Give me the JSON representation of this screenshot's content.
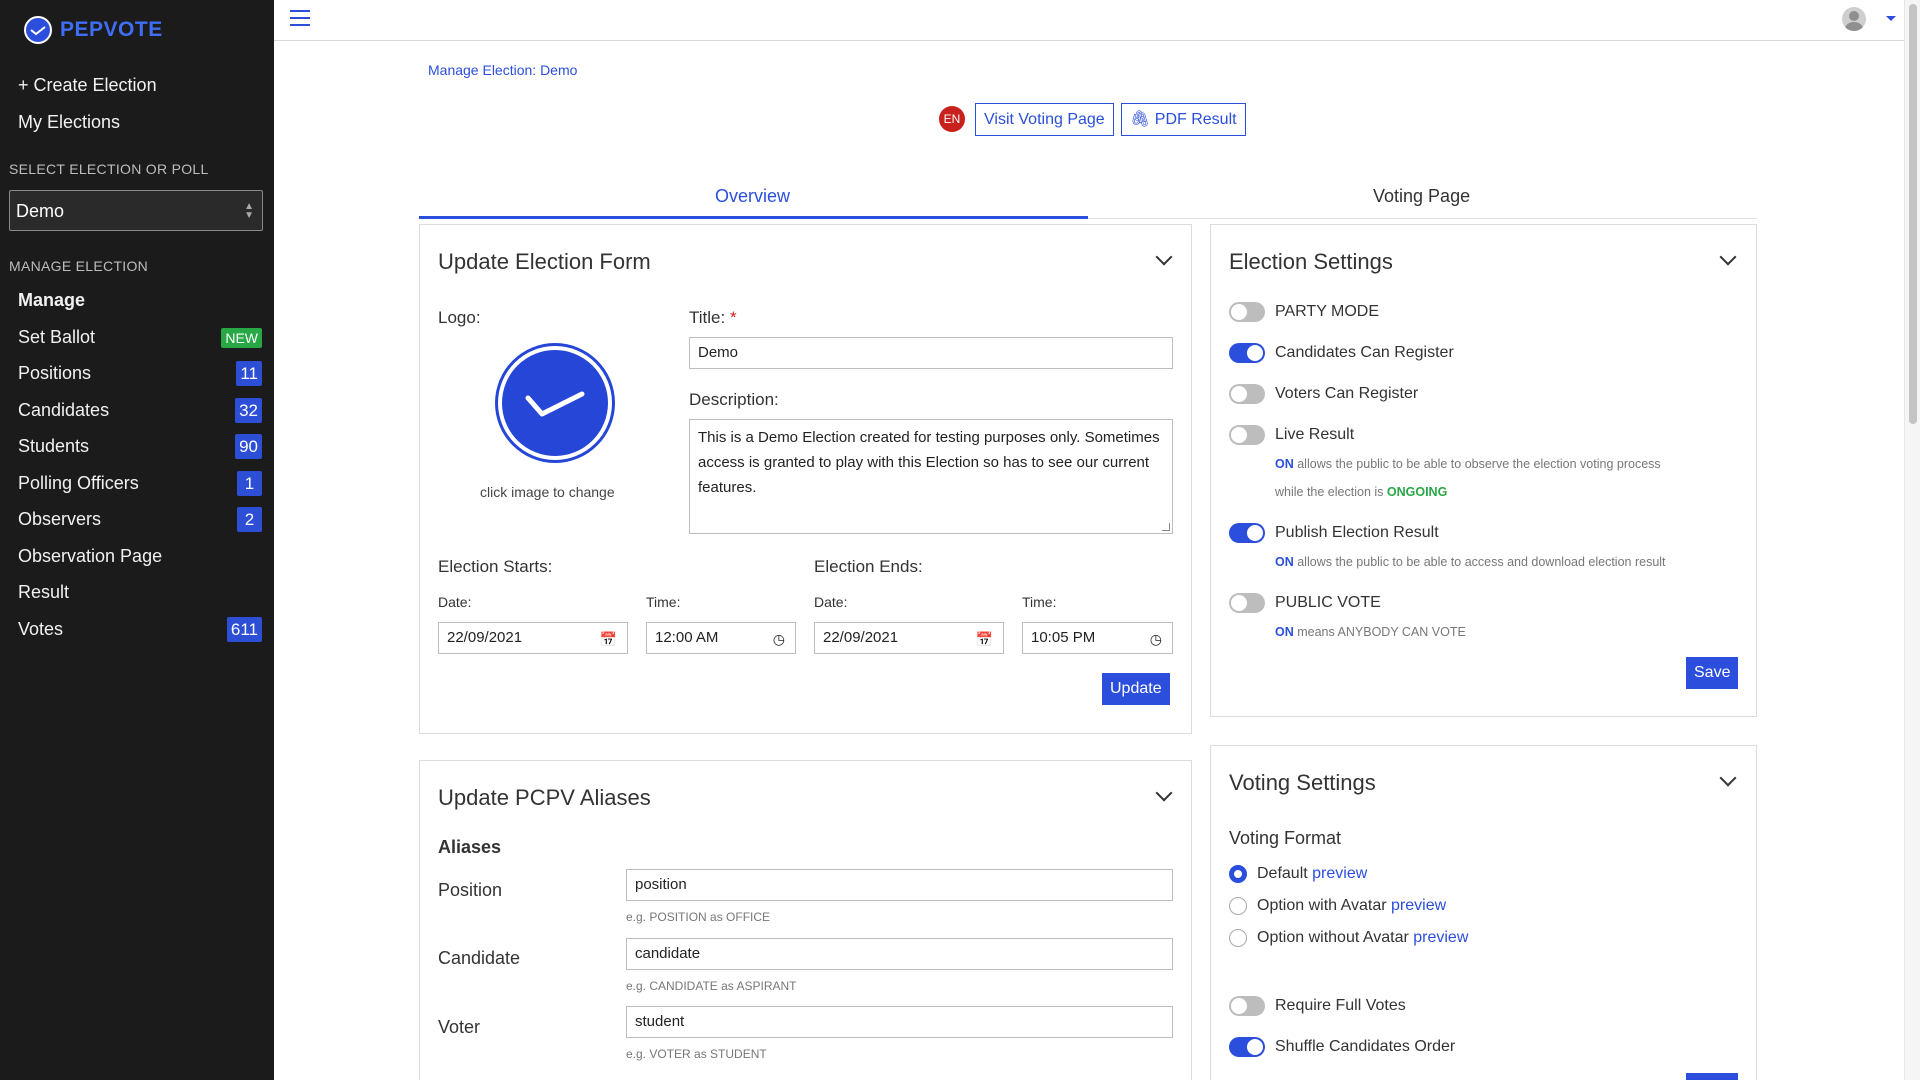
{
  "sidebar": {
    "brand": "PEPVOTE",
    "create_election": "+ Create Election",
    "my_elections": "My Elections",
    "select_section": "SELECT ELECTION OR POLL",
    "selected_election": "Demo",
    "manage_section": "MANAGE ELECTION",
    "items": [
      {
        "label": "Manage",
        "badge": ""
      },
      {
        "label": "Set Ballot",
        "badge": "NEW"
      },
      {
        "label": "Positions",
        "badge": "11"
      },
      {
        "label": "Candidates",
        "badge": "32"
      },
      {
        "label": "Students",
        "badge": "90"
      },
      {
        "label": "Polling Officers",
        "badge": "1"
      },
      {
        "label": "Observers",
        "badge": "2"
      },
      {
        "label": "Observation Page",
        "badge": ""
      },
      {
        "label": "Result",
        "badge": ""
      },
      {
        "label": "Votes",
        "badge": "611"
      }
    ]
  },
  "header": {
    "breadcrumb": "Manage Election: Demo",
    "lang": "EN",
    "visit_voting_page": "Visit Voting Page",
    "pdf_result": "PDF Result"
  },
  "tabs": [
    {
      "label": "Overview",
      "active": true
    },
    {
      "label": "Voting Page",
      "active": false
    }
  ],
  "election_form": {
    "title": "Update Election Form",
    "logo_label": "Logo:",
    "logo_hint": "click image to change",
    "title_label": "Title:",
    "required_mark": "*",
    "title_value": "Demo",
    "description_label": "Description:",
    "description_value": "This is a Demo Election created for testing purposes only. Sometimes access is granted to play with this Election so has to see our current features.",
    "starts_label": "Election Starts:",
    "ends_label": "Election Ends:",
    "date_label": "Date:",
    "time_label": "Time:",
    "start_date": "22/09/2021",
    "start_time": "12:00  AM",
    "end_date": "22/09/2021",
    "end_time": "10:05  PM",
    "update_button": "Update"
  },
  "aliases": {
    "title": "Update PCPV Aliases",
    "subtitle": "Aliases",
    "position_label": "Position",
    "position_value": "position",
    "position_help": "e.g. POSITION as OFFICE",
    "candidate_label": "Candidate",
    "candidate_value": "candidate",
    "candidate_help": "e.g. CANDIDATE as ASPIRANT",
    "voter_label": "Voter",
    "voter_value": "student",
    "voter_help": "e.g. VOTER as STUDENT"
  },
  "election_settings": {
    "title": "Election Settings",
    "party_mode": "PARTY MODE",
    "candidates_register": "Candidates Can Register",
    "voters_register": "Voters Can Register",
    "live_result": "Live Result",
    "live_note_on": "ON",
    "live_note_text": "allows the public to be able to observe the election voting process",
    "live_note_text2": "while the election is",
    "live_note_ongoing": "ONGOING",
    "publish_result": "Publish Election Result",
    "publish_note_on": "ON",
    "publish_note_text": "allows the public to be able to access and download election result",
    "public_vote": "PUBLIC VOTE",
    "public_note_on": "ON",
    "public_note_text": "means ANYBODY CAN VOTE",
    "save_button": "Save"
  },
  "voting_settings": {
    "title": "Voting Settings",
    "format_label": "Voting Format",
    "option_default": "Default",
    "option_avatar": "Option with Avatar",
    "option_no_avatar": "Option without Avatar",
    "preview": "preview",
    "require_full_votes": "Require Full Votes",
    "shuffle_candidates": "Shuffle Candidates Order"
  },
  "colors": {
    "accent": "#2b4fdc",
    "sidebar_bg": "#1b1b1b",
    "success": "#28a745",
    "danger": "#c9211e"
  }
}
